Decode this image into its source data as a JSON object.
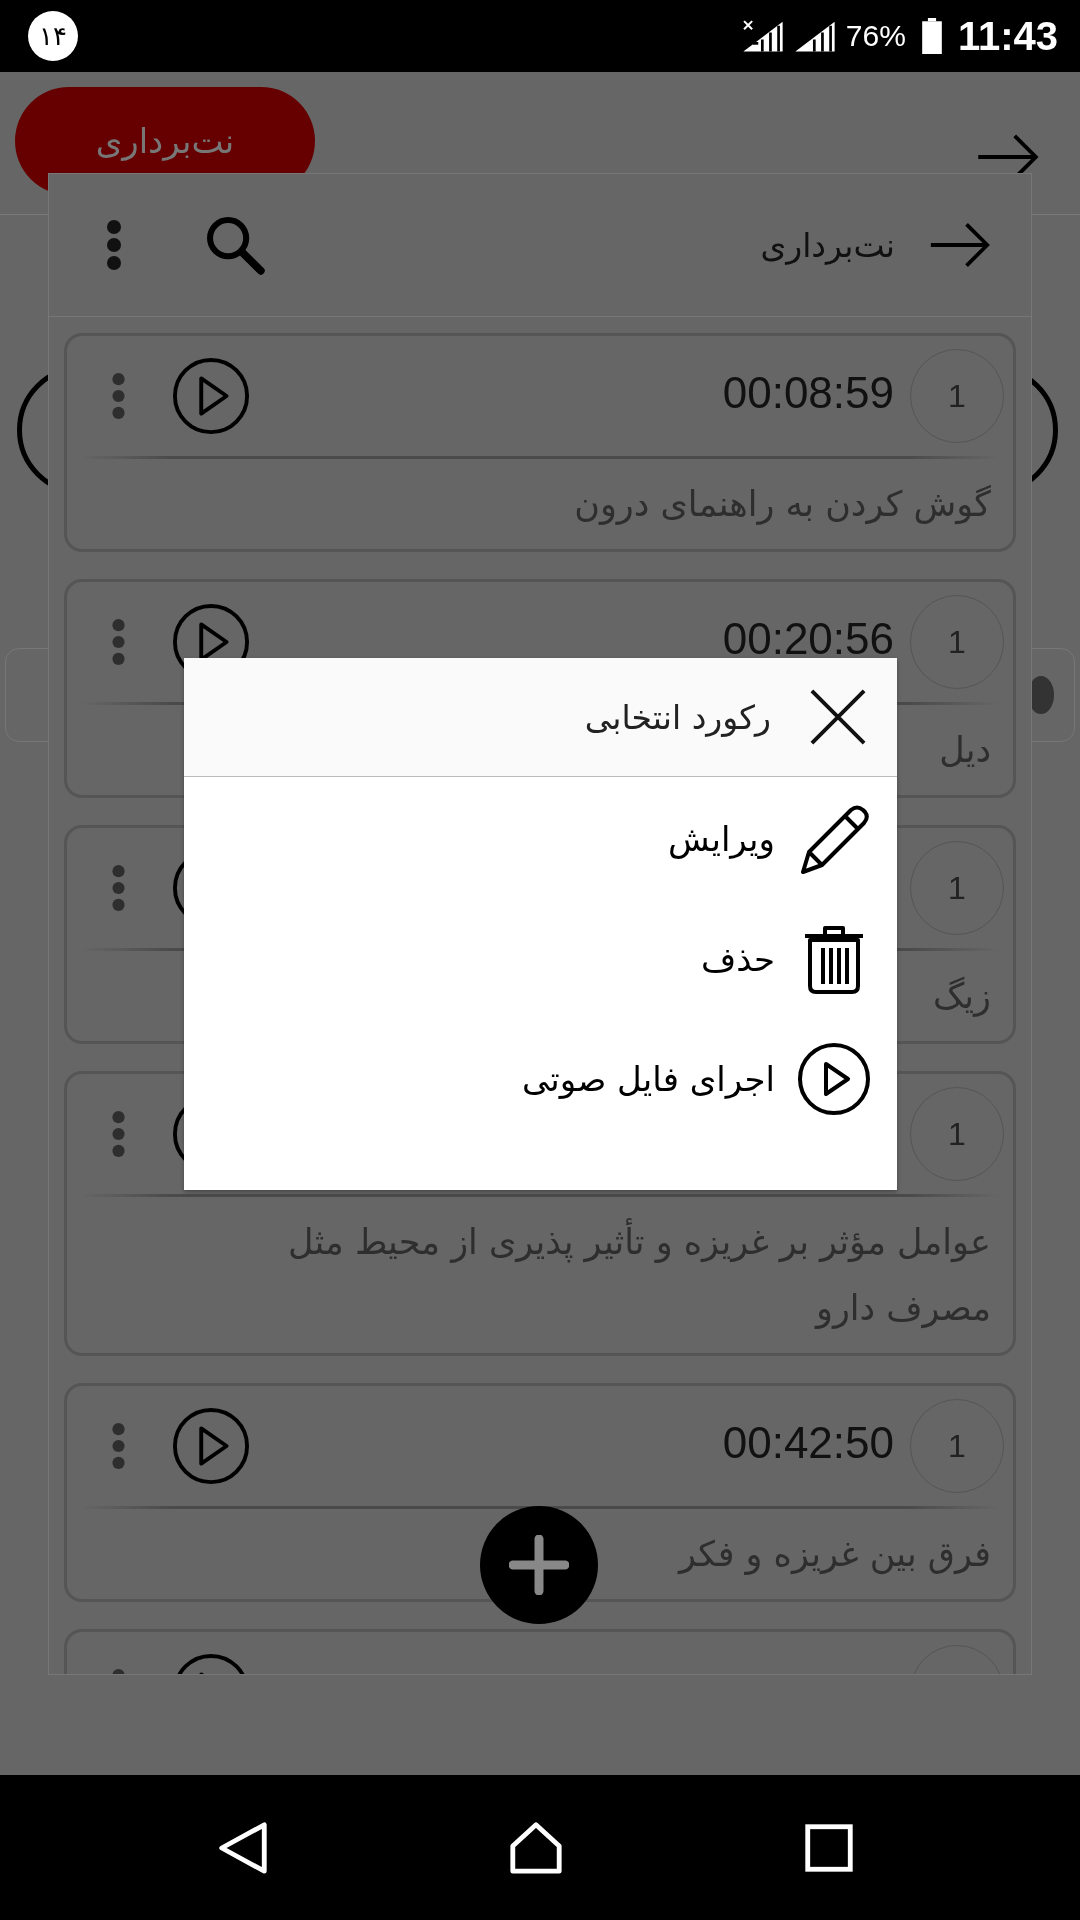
{
  "status_bar": {
    "notification_badge": "۱۴",
    "battery_percent": "76%",
    "time": "11:43"
  },
  "background_app": {
    "header_button": "نت‌برداری"
  },
  "header": {
    "title": "نت‌برداری"
  },
  "records": [
    {
      "number": "1",
      "duration": "00:08:59",
      "title": "گوش کردن به راهنمای درون"
    },
    {
      "number": "1",
      "duration": "00:20:56",
      "title": "دیل"
    },
    {
      "number": "1",
      "title": "زیگ"
    },
    {
      "number": "1",
      "title": "عوامل مؤثر بر غریزه و تأثیر پذیری از محیط مثل مصرف دارو"
    },
    {
      "number": "1",
      "duration": "00:42:50",
      "title": "فرق بین غریزه و فکر"
    }
  ],
  "list_continues": true,
  "dialog": {
    "title": "رکورد انتخابی",
    "actions": [
      {
        "kind": "edit",
        "label": "ویرایش"
      },
      {
        "kind": "delete",
        "label": "حذف"
      },
      {
        "kind": "play",
        "label": "اجرای فایل صوتی"
      }
    ]
  }
}
